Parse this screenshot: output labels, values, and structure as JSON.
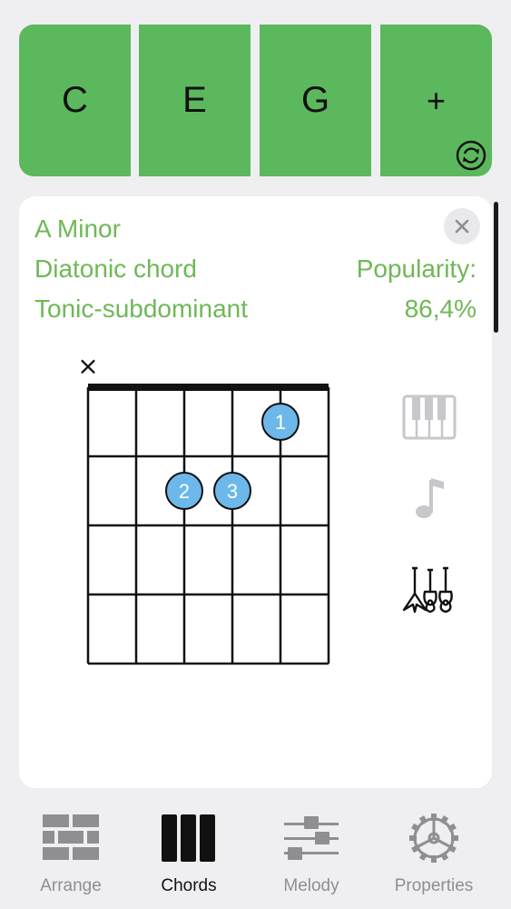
{
  "chord_buttons": [
    {
      "label": "C"
    },
    {
      "label": "E"
    },
    {
      "label": "G"
    },
    {
      "label": "+",
      "icon": "refresh-icon"
    }
  ],
  "chord_info": {
    "name": "A Minor",
    "type": "Diatonic chord",
    "function": "Tonic-subdominant",
    "popularity_label": "Popularity:",
    "popularity_value": "86,4%"
  },
  "fretboard": {
    "muted_marker": "×",
    "fingers": [
      {
        "label": "1",
        "string": 5,
        "fret": 1
      },
      {
        "label": "2",
        "string": 3,
        "fret": 2
      },
      {
        "label": "3",
        "string": 4,
        "fret": 2
      }
    ],
    "muted_strings": [
      1
    ]
  },
  "side_icons": [
    "piano-icon",
    "music-note-icon",
    "guitars-icon"
  ],
  "colors": {
    "accent": "#5cb85c",
    "info_text": "#6fb857",
    "finger_dot": "#6cb8ea",
    "tab_active": "#111111",
    "tab_inactive": "#8e8e93"
  },
  "tabs": [
    {
      "label": "Arrange",
      "icon": "bricks-icon",
      "active": false
    },
    {
      "label": "Chords",
      "icon": "chord-bars-icon",
      "active": true
    },
    {
      "label": "Melody",
      "icon": "sliders-icon",
      "active": false
    },
    {
      "label": "Properties",
      "icon": "gear-icon",
      "active": false
    }
  ]
}
